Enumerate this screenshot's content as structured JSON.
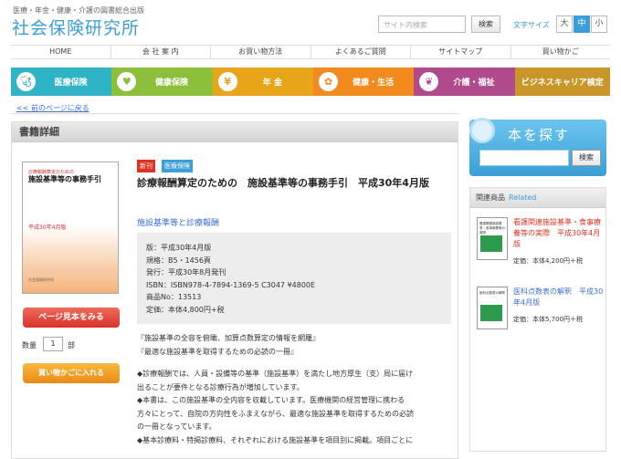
{
  "header": {
    "tagline": "医療・年金・健康・介護の図書総合出版",
    "logo": "社会保険研究所",
    "search_placeholder": "サイト内検索",
    "search_button": "検索",
    "font_size_label": "文字サイズ",
    "font_sizes": [
      "大",
      "中",
      "小"
    ]
  },
  "global_nav": [
    "HOME",
    "会 社 案 内",
    "お買い物方法",
    "よくあるご質問",
    "サイトマップ",
    "買い物かご"
  ],
  "category_nav": [
    {
      "label": "医療保険",
      "color": "#2fb3c7",
      "icon": "🩺"
    },
    {
      "label": "健康保険",
      "color": "#8cbf3a",
      "icon": "♥"
    },
    {
      "label": "年 金",
      "color": "#e8a519",
      "icon": "¥"
    },
    {
      "label": "健康・生活",
      "color": "#f28a1e",
      "icon": "✿"
    },
    {
      "label": "介護・福祉",
      "color": "#b04a8d",
      "icon": "❦"
    },
    {
      "label": "ビジネスキャリア検定",
      "color": "#c9962a",
      "icon": ""
    }
  ],
  "back_link": "<< 前のページに戻る",
  "book": {
    "section_title": "書籍詳細",
    "badge_new": "新刊",
    "badge_category": "医療保険",
    "title": "診療報酬算定のための　施設基準等の事務手引　平成30年4月版",
    "subtitle": "施設基準等と診療報酬",
    "info": [
      "版：平成30年4月版",
      "規格：B5・1456頁",
      "発行：平成30年8月発刊",
      "ISBN：ISBN978-4-7894-1369-5 C3047 ¥4800E",
      "商品No：13513",
      "定価：本体4,800円+税"
    ],
    "description": [
      "『施設基準の全容を俯瞰、加算点数算定の情報を網羅』",
      "『最適な施設基準を取得するための必読の一冊』",
      "",
      "◆診療報酬では、人員・設備等の基準（施設基準）を満たし地方厚生（支）局に届け",
      "出ることが要件となる診療行為が増加しています。",
      "◆本書は、この施設基準の全内容を収載しています。医療機関の経営管理に携わる",
      "方々にとって、自院の方向性をふまえながら、最適な施設基準を取得するための必読",
      "の一冊となっています。",
      "◆基本診療料・特掲診療料、それぞれにおける施設基準を項目別に掲載。項目ごとに"
    ],
    "cover": {
      "small": "診療報酬算定のための",
      "title": "施設基準等の事務手引",
      "year": "平成30年4月版",
      "publisher": "社会保険研究所"
    },
    "sample_button": "ページ見本をみる",
    "qty_label": "数量",
    "qty_value": "1",
    "qty_unit": "部",
    "cart_button": "買い物かごに入れる"
  },
  "sidebar": {
    "search_title": "本を探す",
    "search_button": "検索",
    "related_title": "関連商品",
    "related_title_en": "Related",
    "related": [
      {
        "title": "看護関連施設基準・食事療養等の実際　平成30年4月版",
        "price": "定価：本体4,200円＋税",
        "thumb": "看護関連施設基準・食事療養等の実際"
      },
      {
        "title": "医科点数表の解釈　平成30年4月版",
        "price": "定価：本体5,700円＋税",
        "thumb": "医科点数表の解釈"
      }
    ]
  }
}
